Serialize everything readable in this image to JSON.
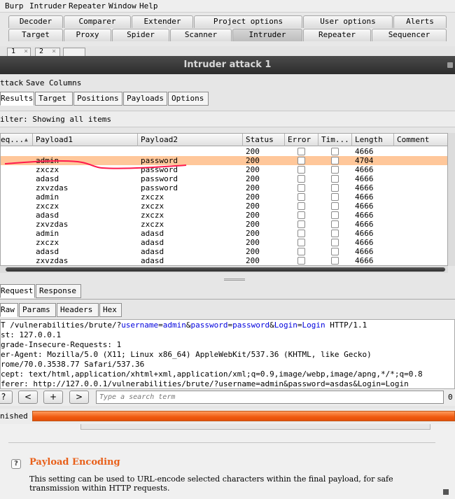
{
  "app_menu": [
    "Burp",
    "Intruder",
    "Repeater",
    "Window",
    "Help"
  ],
  "main_tabs_row1": [
    "Decoder",
    "Comparer",
    "Extender",
    "Project options",
    "User options",
    "Alerts"
  ],
  "main_tabs_row2": [
    "Target",
    "Proxy",
    "Spider",
    "Scanner",
    "Intruder",
    "Repeater",
    "Sequencer"
  ],
  "sub_tabs": [
    "1",
    "2"
  ],
  "sub_tab_close": "×",
  "window_title": "Intruder attack 1",
  "attack_menu": [
    "ttack",
    "Save",
    "Columns"
  ],
  "result_tabs": [
    "Results",
    "Target",
    "Positions",
    "Payloads",
    "Options"
  ],
  "filter_text": "ilter: Showing all items",
  "table": {
    "headers": [
      "eq...",
      "Payload1",
      "Payload2",
      "Status",
      "Error",
      "Tim...",
      "Length",
      "Comment"
    ],
    "sort_icon": "▲",
    "rows": [
      {
        "p1": "",
        "p2": "",
        "status": "200",
        "length": "4666"
      },
      {
        "p1": "admin",
        "p2": "password",
        "status": "200",
        "length": "4704"
      },
      {
        "p1": "zxczx",
        "p2": "password",
        "status": "200",
        "length": "4666"
      },
      {
        "p1": "adasd",
        "p2": "password",
        "status": "200",
        "length": "4666"
      },
      {
        "p1": "zxvzdas",
        "p2": "password",
        "status": "200",
        "length": "4666"
      },
      {
        "p1": "admin",
        "p2": "zxczx",
        "status": "200",
        "length": "4666"
      },
      {
        "p1": "zxczx",
        "p2": "zxczx",
        "status": "200",
        "length": "4666"
      },
      {
        "p1": "adasd",
        "p2": "zxczx",
        "status": "200",
        "length": "4666"
      },
      {
        "p1": "zxvzdas",
        "p2": "zxczx",
        "status": "200",
        "length": "4666"
      },
      {
        "p1": "admin",
        "p2": "adasd",
        "status": "200",
        "length": "4666"
      },
      {
        "p1": "zxczx",
        "p2": "adasd",
        "status": "200",
        "length": "4666"
      },
      {
        "p1": "adasd",
        "p2": "adasd",
        "status": "200",
        "length": "4666"
      },
      {
        "p1": "zxvzdas",
        "p2": "adasd",
        "status": "200",
        "length": "4666"
      }
    ]
  },
  "detail_tabs": [
    "Request",
    "Response"
  ],
  "format_tabs": [
    "Raw",
    "Params",
    "Headers",
    "Hex"
  ],
  "request": {
    "line1": {
      "prefix": "T /vulnerabilities/brute/?",
      "k1": "username",
      "eq1": "=",
      "v1": "admin",
      "amp1": "&",
      "k2": "password",
      "eq2": "=",
      "v2": "password",
      "amp2": "&",
      "k3": "Login",
      "eq3": "=",
      "v3": "Login",
      "suffix": " HTTP/1.1"
    },
    "lines": [
      "st: 127.0.0.1",
      "grade-Insecure-Requests: 1",
      "er-Agent: Mozilla/5.0 (X11; Linux x86_64) AppleWebKit/537.36 (KHTML, like Gecko)",
      "rome/70.0.3538.77 Safari/537.36",
      "cept: text/html,application/xhtml+xml,application/xml;q=0.9,image/webp,image/apng,*/*;q=0.8",
      "ferer: http://127.0.0.1/vulnerabilities/brute/?username=admin&password=asdas&Login=Login"
    ]
  },
  "search": {
    "help": "?",
    "prev": "<",
    "add": "+",
    "next": ">",
    "placeholder": "Type a search term",
    "matches": "0"
  },
  "status_text": "nished",
  "progress": 1.0,
  "payload_encoding": {
    "help": "?",
    "title": "Payload Encoding",
    "desc1": "This setting can be used to URL-encode selected characters within the final payload, for safe",
    "desc2": "transmission within HTTP requests."
  },
  "colors": {
    "selected_row": "#ffc79a",
    "progress": "#f05a10",
    "heading": "#e8601a",
    "param_highlight": "#0000dd",
    "annotation": "#ff1a4d"
  }
}
